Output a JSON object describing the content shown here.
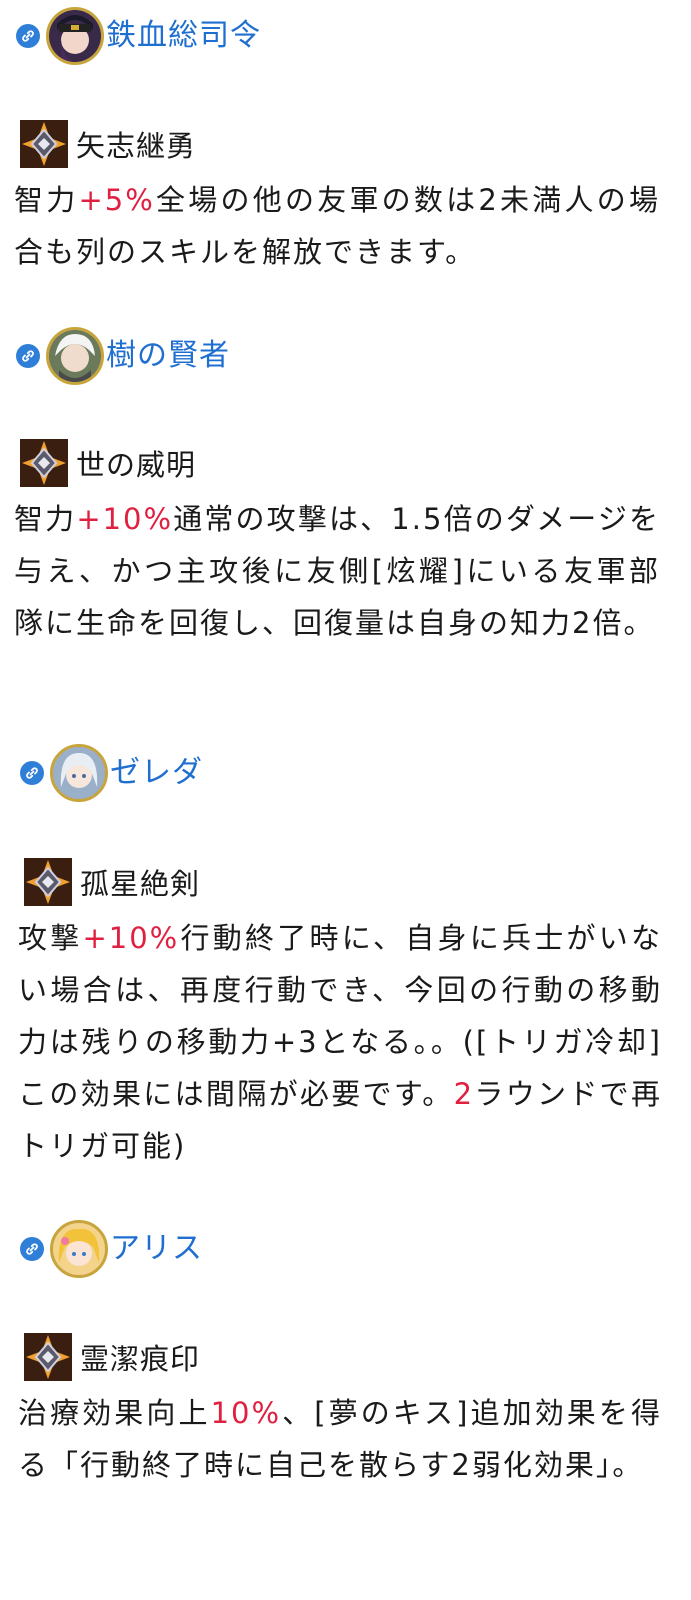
{
  "entries": [
    {
      "name": "鉄血総司令",
      "skill": "矢志継勇",
      "desc": [
        "智力",
        "+5%",
        "全場の他の友軍の数は2未満人の場合も列のスキルを解放できます。"
      ]
    },
    {
      "name": "樹の賢者",
      "skill": "世の威明",
      "desc": [
        "智力",
        "+10%",
        "通常の攻撃は、1.5倍のダメージを与え、かつ主攻後に友側[炫耀]にいる友軍部隊に生命を回復し、回復量は自身の知力2倍。"
      ]
    },
    {
      "name": "ゼレダ",
      "skill": "孤星絶剣",
      "desc": [
        "攻撃",
        "+10%",
        "行動終了時に、自身に兵士がいない場合は、再度行動でき、今回の行動の移動力は残りの移動力+3となる。。([トリガ冷却]この効果には間隔が必要です。",
        "2",
        "ラウンドで再トリガ可能)"
      ]
    },
    {
      "name": "アリス",
      "skill": "霊潔痕印",
      "desc": [
        "治療効果向上",
        "10%",
        "、[夢のキス]追加効果を得る「行動終了時に自己を散らす2弱化効果」。"
      ]
    }
  ],
  "colors": {
    "link": "#1f6fd1",
    "highlight": "#e02040",
    "text": "#1a1a1a"
  },
  "icons": {
    "link": "link-icon",
    "skill": "skill-emblem-icon"
  }
}
